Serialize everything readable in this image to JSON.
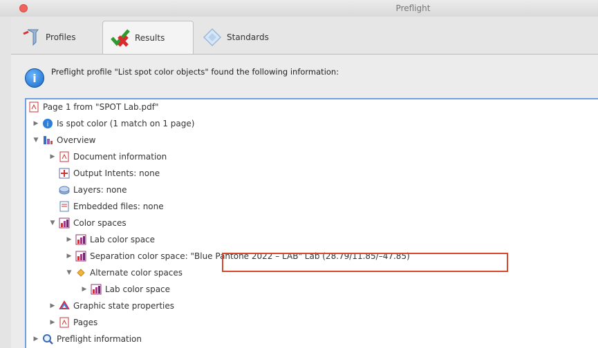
{
  "window": {
    "title": "Preflight"
  },
  "tabs": {
    "profiles": "Profiles",
    "results": "Results",
    "standards": "Standards"
  },
  "info": {
    "message": "Preflight profile \"List spot color objects\" found the following information:"
  },
  "tree": [
    {
      "label": "Page 1 from \"SPOT Lab.pdf\""
    },
    {
      "label": "Is spot color (1 match on 1 page)"
    },
    {
      "label": "Overview"
    },
    {
      "label": "Document information"
    },
    {
      "label": "Output Intents: none"
    },
    {
      "label": "Layers: none"
    },
    {
      "label": "Embedded files: none"
    },
    {
      "label": "Color spaces"
    },
    {
      "label": "Lab color space"
    },
    {
      "label": "Separation color space: \"Blue Pantone 2022 – LAB\" Lab (28.79/11.85/–47.85)"
    },
    {
      "label": "Alternate color spaces"
    },
    {
      "label": "Lab color space"
    },
    {
      "label": "Graphic state properties"
    },
    {
      "label": "Pages"
    },
    {
      "label": "Preflight information"
    }
  ]
}
